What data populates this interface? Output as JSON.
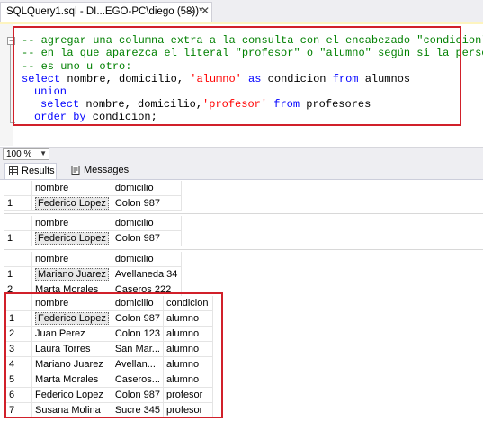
{
  "tab": {
    "title": "SQLQuery1.sql - DI...EGO-PC\\diego (58))*",
    "pin": "⊸",
    "close": "✕"
  },
  "code": {
    "line1": "-- agregar una columna extra a la consulta con el encabezado \"condicion\"",
    "line2": "-- en la que aparezca el literal \"profesor\" o \"alumno\" según si la persona",
    "line3": "-- es uno u otro:",
    "line4": {
      "kw1": "select",
      "t1": " nombre, domicilio, ",
      "s1": "'alumno'",
      "kw2": " as",
      "t2": " condicion ",
      "kw3": "from",
      "t3": " alumnos"
    },
    "line5": {
      "kw": "union"
    },
    "line6": {
      "kw1": "select",
      "t1": " nombre, domicilio,",
      "s1": "'profesor'",
      "kw2": " from",
      "t2": " profesores"
    },
    "line7": {
      "kw": "order by",
      "t": " condicion;"
    }
  },
  "zoom": {
    "value": "100 %"
  },
  "result_tabs": {
    "results": "Results",
    "messages": "Messages"
  },
  "grids": [
    {
      "headers": [
        "nombre",
        "domicilio"
      ],
      "rows": [
        [
          "1",
          "Federico Lopez",
          "Colon 987"
        ]
      ]
    },
    {
      "headers": [
        "nombre",
        "domicilio"
      ],
      "rows": [
        [
          "1",
          "Federico Lopez",
          "Colon 987"
        ]
      ]
    },
    {
      "headers": [
        "nombre",
        "domicilio"
      ],
      "rows": [
        [
          "1",
          "Mariano Juarez",
          "Avellaneda 34"
        ],
        [
          "2",
          "Marta Morales",
          "Caseros 222"
        ]
      ]
    },
    {
      "headers": [
        "nombre",
        "domicilio",
        "condicion"
      ],
      "rows": [
        [
          "1",
          "Federico Lopez",
          "Colon 987",
          "alumno"
        ],
        [
          "2",
          "Juan Perez",
          "Colon 123",
          "alumno"
        ],
        [
          "3",
          "Laura Torres",
          "San Mar...",
          "alumno"
        ],
        [
          "4",
          "Mariano Juarez",
          "Avellan...",
          "alumno"
        ],
        [
          "5",
          "Marta Morales",
          "Caseros...",
          "alumno"
        ],
        [
          "6",
          "Federico Lopez",
          "Colon 987",
          "profesor"
        ],
        [
          "7",
          "Susana Molina",
          "Sucre 345",
          "profesor"
        ]
      ]
    }
  ],
  "colors": {
    "highlight_box": "#d1202a",
    "keyword": "#0000ff",
    "string": "#ff0000",
    "comment": "#008000"
  }
}
